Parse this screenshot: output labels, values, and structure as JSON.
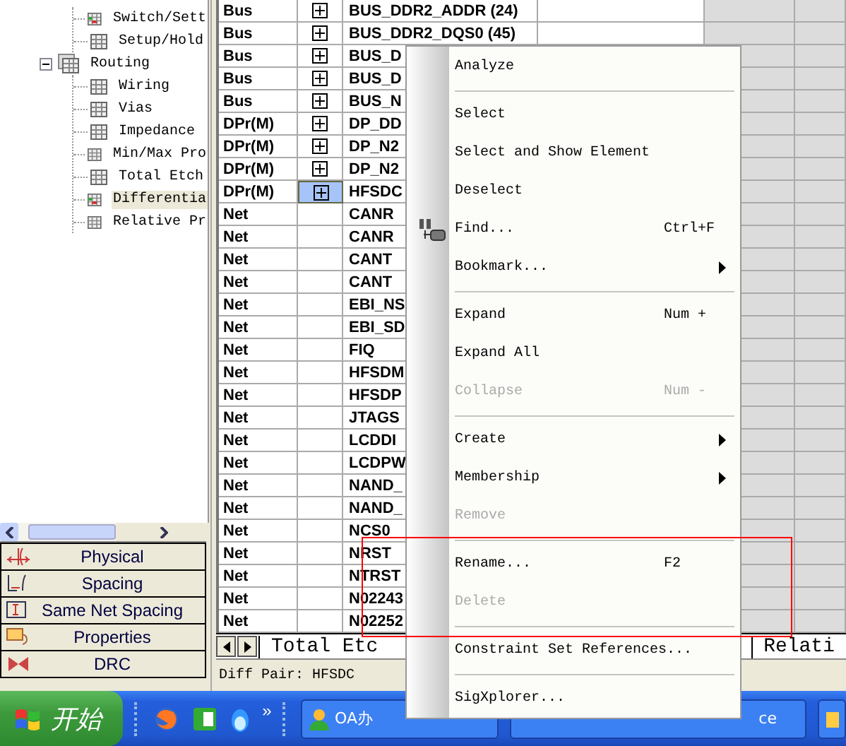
{
  "tree": [
    {
      "children": [
        {
          "label": "Switch/Sett",
          "kind": "marked",
          "selected": false
        },
        {
          "label": "Setup/Hold",
          "kind": "plain",
          "selected": false
        }
      ]
    },
    {
      "label": "Routing",
      "expanded": true,
      "children": [
        {
          "label": "Wiring",
          "kind": "plain",
          "selected": false
        },
        {
          "label": "Vias",
          "kind": "plain",
          "selected": false
        },
        {
          "label": "Impedance",
          "kind": "plain",
          "selected": false
        },
        {
          "label": "Min/Max Pro",
          "kind": "plain",
          "selected": false
        },
        {
          "label": "Total Etch",
          "kind": "plain",
          "selected": false
        },
        {
          "label": "Differentia",
          "kind": "marked",
          "selected": true
        },
        {
          "label": "Relative Pr",
          "kind": "plain",
          "selected": false
        }
      ]
    }
  ],
  "categories": [
    {
      "label": "Physical"
    },
    {
      "label": "Spacing"
    },
    {
      "label": "Same Net Spacing"
    },
    {
      "label": "Properties"
    },
    {
      "label": "DRC"
    }
  ],
  "rows": [
    {
      "type": "Bus",
      "expandable": true,
      "name": "BUS_DDR2_ADDR (24)",
      "selected": false
    },
    {
      "type": "Bus",
      "expandable": true,
      "name": "BUS_DDR2_DQS0 (45)",
      "selected": false
    },
    {
      "type": "Bus",
      "expandable": true,
      "name": "BUS_D",
      "selected": false
    },
    {
      "type": "Bus",
      "expandable": true,
      "name": "BUS_D",
      "selected": false
    },
    {
      "type": "Bus",
      "expandable": true,
      "name": "BUS_N",
      "selected": false
    },
    {
      "type": "DPr(M)",
      "expandable": true,
      "name": "DP_DD",
      "selected": false
    },
    {
      "type": "DPr(M)",
      "expandable": true,
      "name": "DP_N2",
      "selected": false
    },
    {
      "type": "DPr(M)",
      "expandable": true,
      "name": "DP_N2",
      "selected": false
    },
    {
      "type": "DPr(M)",
      "expandable": true,
      "name": "HFSDC",
      "selected": true
    },
    {
      "type": "Net",
      "expandable": false,
      "name": "CANR",
      "selected": false
    },
    {
      "type": "Net",
      "expandable": false,
      "name": "CANR",
      "selected": false
    },
    {
      "type": "Net",
      "expandable": false,
      "name": "CANT",
      "selected": false
    },
    {
      "type": "Net",
      "expandable": false,
      "name": "CANT",
      "selected": false
    },
    {
      "type": "Net",
      "expandable": false,
      "name": "EBI_NS",
      "selected": false
    },
    {
      "type": "Net",
      "expandable": false,
      "name": "EBI_SD",
      "selected": false
    },
    {
      "type": "Net",
      "expandable": false,
      "name": "FIQ",
      "selected": false
    },
    {
      "type": "Net",
      "expandable": false,
      "name": "HFSDM",
      "selected": false
    },
    {
      "type": "Net",
      "expandable": false,
      "name": "HFSDP",
      "selected": false
    },
    {
      "type": "Net",
      "expandable": false,
      "name": "JTAGS",
      "selected": false
    },
    {
      "type": "Net",
      "expandable": false,
      "name": "LCDDI",
      "selected": false
    },
    {
      "type": "Net",
      "expandable": false,
      "name": "LCDPW",
      "selected": false
    },
    {
      "type": "Net",
      "expandable": false,
      "name": "NAND_",
      "selected": false
    },
    {
      "type": "Net",
      "expandable": false,
      "name": "NAND_",
      "selected": false
    },
    {
      "type": "Net",
      "expandable": false,
      "name": "NCS0",
      "selected": false
    },
    {
      "type": "Net",
      "expandable": false,
      "name": "NRST",
      "selected": false
    },
    {
      "type": "Net",
      "expandable": false,
      "name": "NTRST",
      "selected": false
    },
    {
      "type": "Net",
      "expandable": false,
      "name": "N02243",
      "selected": false
    },
    {
      "type": "Net",
      "expandable": false,
      "name": "N02252",
      "selected": false
    }
  ],
  "sheet_tabs": [
    {
      "label": "Total Etc",
      "selected": false
    },
    {
      "label": "Relati",
      "selected": false
    }
  ],
  "status_bar": "Diff Pair: HFSDC",
  "context_menu": [
    {
      "kind": "item",
      "label": "Analyze",
      "disabled": false,
      "submenu": false
    },
    {
      "kind": "separator"
    },
    {
      "kind": "item",
      "label": "Select",
      "disabled": false,
      "submenu": false
    },
    {
      "kind": "item",
      "label": "Select and Show Element",
      "disabled": false,
      "submenu": false
    },
    {
      "kind": "item",
      "label": "Deselect",
      "disabled": false,
      "submenu": false
    },
    {
      "kind": "item",
      "label": "Find...",
      "shortcut": "Ctrl+F",
      "icon": true,
      "disabled": false,
      "submenu": false
    },
    {
      "kind": "item",
      "label": "Bookmark...",
      "disabled": false,
      "submenu": true
    },
    {
      "kind": "separator"
    },
    {
      "kind": "item",
      "label": "Expand",
      "shortcut": "Num +",
      "disabled": false,
      "submenu": false
    },
    {
      "kind": "item",
      "label": "Expand All",
      "disabled": false,
      "submenu": false
    },
    {
      "kind": "item",
      "label": "Collapse",
      "shortcut": "Num -",
      "disabled": true,
      "submenu": false
    },
    {
      "kind": "separator"
    },
    {
      "kind": "item",
      "label": "Create",
      "disabled": false,
      "submenu": true
    },
    {
      "kind": "item",
      "label": "Membership",
      "disabled": false,
      "submenu": true
    },
    {
      "kind": "item",
      "label": "Remove",
      "disabled": true,
      "submenu": false
    },
    {
      "kind": "separator"
    },
    {
      "kind": "item",
      "label": "Rename...",
      "shortcut": "F2",
      "disabled": false,
      "submenu": false
    },
    {
      "kind": "item",
      "label": "Delete",
      "disabled": true,
      "submenu": false
    },
    {
      "kind": "separator"
    },
    {
      "kind": "item",
      "label": "Constraint Set References...",
      "disabled": false,
      "submenu": false
    },
    {
      "kind": "separator"
    },
    {
      "kind": "item",
      "label": "SigXplorer...",
      "disabled": false,
      "submenu": false
    }
  ],
  "taskbar": {
    "start": "开始",
    "chevron": "»",
    "tasks": [
      {
        "label": "OA办"
      },
      {
        "label": "ce"
      }
    ]
  }
}
